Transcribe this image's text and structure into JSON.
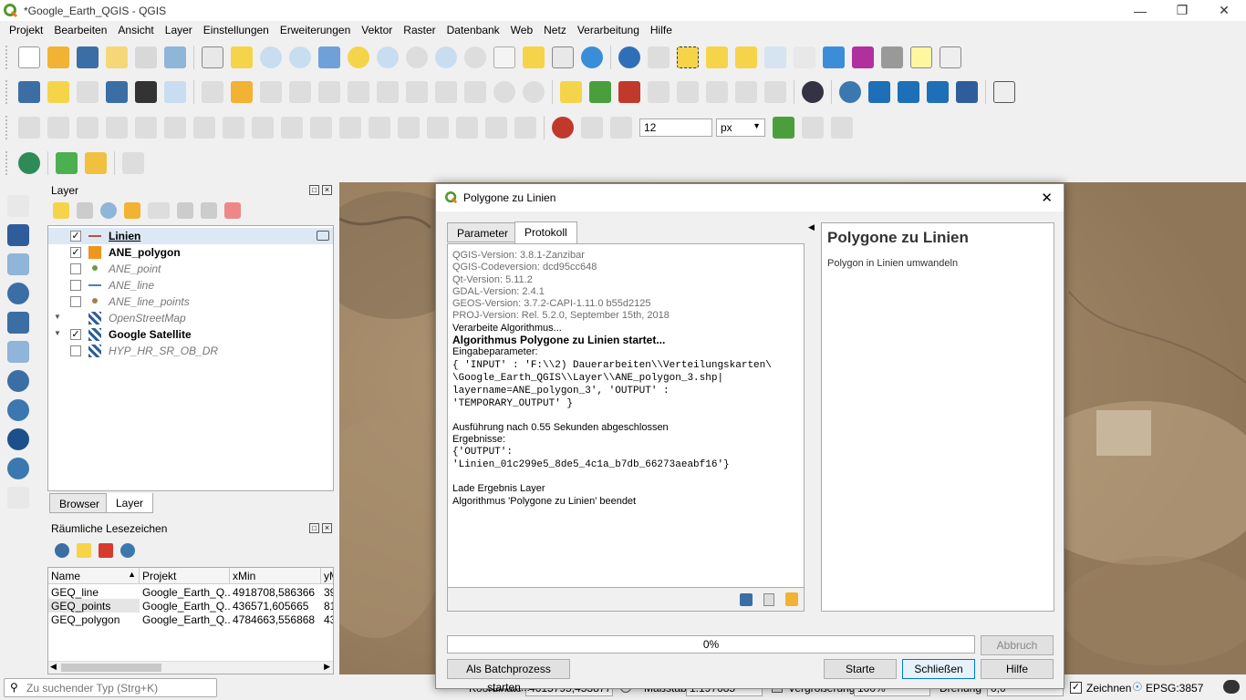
{
  "window": {
    "title": "*Google_Earth_QGIS - QGIS"
  },
  "menu": [
    "Projekt",
    "Bearbeiten",
    "Ansicht",
    "Layer",
    "Einstellungen",
    "Erweiterungen",
    "Vektor",
    "Raster",
    "Datenbank",
    "Web",
    "Netz",
    "Verarbeitung",
    "Hilfe"
  ],
  "toolbar": {
    "snap_tolerance": "12",
    "snap_unit": "px"
  },
  "layers": {
    "title": "Layer",
    "items": [
      {
        "name": "Linien",
        "checked": "✓"
      },
      {
        "name": "ANE_polygon",
        "checked": "✓"
      },
      {
        "name": "ANE_point",
        "checked": ""
      },
      {
        "name": "ANE_line",
        "checked": ""
      },
      {
        "name": "ANE_line_points",
        "checked": ""
      },
      {
        "name": "OpenStreetMap",
        "checked": ""
      },
      {
        "name": "Google Satellite",
        "checked": "✓"
      },
      {
        "name": "HYP_HR_SR_OB_DR",
        "checked": ""
      }
    ],
    "tabs": [
      "Browser",
      "Layer"
    ]
  },
  "bookmarks": {
    "title": "Räumliche Lesezeichen",
    "columns": [
      "Name",
      "Projekt",
      "xMin",
      "yM"
    ],
    "rows": [
      [
        "GEQ_line",
        "Google_Earth_Q...",
        "4918708,586366",
        "39"
      ],
      [
        "GEQ_points",
        "Google_Earth_Q...",
        "436571,605665",
        "81"
      ],
      [
        "GEQ_polygon",
        "Google_Earth_Q...",
        "4784663,556868",
        "43"
      ]
    ]
  },
  "search": {
    "placeholder": "Zu suchender Typ (Strg+K)"
  },
  "status": {
    "coordinate_label": "Koordinate",
    "coordinate_value": "4615795,4538776",
    "scale_label": "Maßstab",
    "scale_value": "1:197685",
    "magnifier_label": "Vergrößerung",
    "magnifier_value": "100%",
    "rotation_label": "Drehung",
    "rotation_value": "0,0",
    "render_label": "Zeichnen",
    "render_checked": "✓",
    "crs": "EPSG:3857"
  },
  "dialog": {
    "title": "Polygone zu Linien",
    "tabs": [
      "Parameter",
      "Protokoll"
    ],
    "log": {
      "versions": [
        "QGIS-Version: 3.8.1-Zanzibar",
        "QGIS-Codeversion: dcd95cc648",
        "Qt-Version: 5.11.2",
        "GDAL-Version: 2.4.1",
        "GEOS-Version: 3.7.2-CAPI-1.11.0 b55d2125",
        "PROJ-Version: Rel. 5.2.0, September 15th, 2018"
      ],
      "processing": "Verarbeite Algorithmus...",
      "started": "Algorithmus Polygone zu Linien startet...",
      "input_label": "Eingabeparameter:",
      "input_lines": [
        "{ 'INPUT' : 'F:\\\\2) Dauerarbeiten\\\\Verteilungskarten\\",
        "\\Google_Earth_QGIS\\\\Layer\\\\ANE_polygon_3.shp|",
        "layername=ANE_polygon_3', 'OUTPUT' :",
        "'TEMPORARY_OUTPUT' }"
      ],
      "executed": "Ausführung nach 0.55 Sekunden abgeschlossen",
      "results_label": "Ergebnisse:",
      "result_lines": [
        "{'OUTPUT':",
        "'Linien_01c299e5_8de5_4c1a_b7db_66273aeabf16'}"
      ],
      "loading": "Lade Ergebnis Layer",
      "finished": "Algorithmus 'Polygone zu Linien' beendet"
    },
    "help_title": "Polygone zu Linien",
    "help_text": "Polygon in Linien umwandeln",
    "progress": "0%",
    "abort": "Abbruch",
    "batch": "Als Batchprozess starten...",
    "start": "Starte",
    "close": "Schließen",
    "help": "Hilfe"
  }
}
